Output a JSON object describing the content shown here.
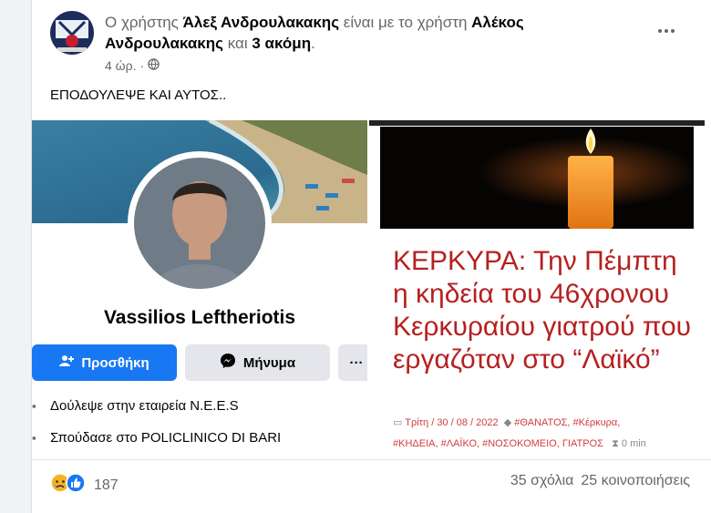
{
  "post": {
    "intro": "Ο χρήστης",
    "author": "Άλεξ Ανδρουλακακης",
    "with_text": "είναι με το χρήστη",
    "tagged": "Αλέκος Ανδρουλακακης",
    "and_text": "και",
    "others": "3 ακόμη",
    "period": ".",
    "time": "4 ώρ.",
    "sep": "·",
    "text": "ΕΠΟΔΟΥΛΕΨΕ ΚΑΙ ΑΥΤΟΣ..",
    "privacy_icon": "globe-icon"
  },
  "profile_card": {
    "name": "Vassilios Leftheriotis",
    "add_label": "Προσθήκη",
    "message_label": "Μήνυμα",
    "more_label": "···",
    "work": "Δούλεψε στην εταιρεία N.E.E.S",
    "study": "Σπούδασε στο POLICLINICO DI BARI"
  },
  "article": {
    "title": "ΚΕΡΚΥΡΑ: Την Πέμπτη η κηδεία του 46χρονου Κερκυραίου γιατρού που εργαζόταν στο “Λαϊκό”",
    "date": "Τρίτη / 30 / 08 / 2022",
    "tags_line1": "#ΘΑΝΑΤΟΣ, #Κέρκυρα,",
    "tags_line2": "#ΚΗΔΕΙΑ, #ΛΑΪΚΟ, #ΝΟΣΟΚΟΜΕΙΟ, ΓΙΑΤΡΟΣ",
    "read_time": "0 min"
  },
  "stats": {
    "reactions": "187",
    "comments": "35 σχόλια",
    "shares": "25 κοινοποιήσεις"
  },
  "colors": {
    "brand_blue": "#1877f2",
    "article_red": "#b62020",
    "tag_red": "#d23c3c"
  }
}
